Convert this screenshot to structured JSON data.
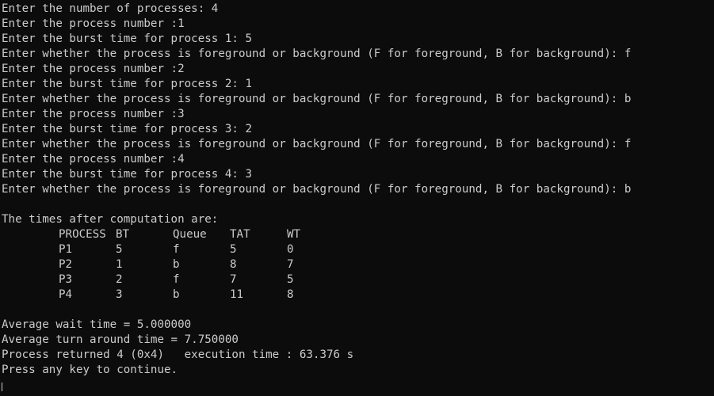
{
  "console": {
    "input_lines": [
      "Enter the number of processes: 4",
      "Enter the process number :1",
      "Enter the burst time for process 1: 5",
      "Enter whether the process is foreground or background (F for foreground, B for background): f",
      "Enter the process number :2",
      "Enter the burst time for process 2: 1",
      "Enter whether the process is foreground or background (F for foreground, B for background): b",
      "Enter the process number :3",
      "Enter the burst time for process 3: 2",
      "Enter whether the process is foreground or background (F for foreground, B for background): f",
      "Enter the process number :4",
      "Enter the burst time for process 4: 3",
      "Enter whether the process is foreground or background (F for foreground, B for background): b"
    ],
    "results_heading": "The times after computation are:",
    "table": {
      "headers": [
        "PROCESS",
        "BT",
        "Queue",
        "TAT",
        "WT"
      ],
      "rows": [
        [
          "P1",
          "5",
          "f",
          "5",
          "0"
        ],
        [
          "P2",
          "1",
          "b",
          "8",
          "7"
        ],
        [
          "P3",
          "2",
          "f",
          "7",
          "5"
        ],
        [
          "P4",
          "3",
          "b",
          "11",
          "8"
        ]
      ]
    },
    "average_wait": "Average wait time = 5.000000",
    "average_turnaround": "Average turn around time = 7.750000",
    "process_returned": "Process returned 4 (0x4)   execution time : 63.376 s",
    "press_any_key": "Press any key to continue."
  }
}
